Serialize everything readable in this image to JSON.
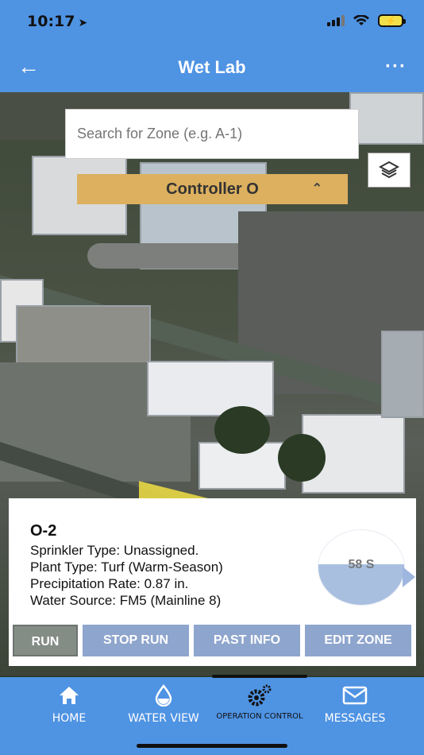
{
  "status_bar": {
    "time": "10:17",
    "battery": "⚡"
  },
  "header": {
    "title": "Wet Lab",
    "back_icon": "back-arrow-icon",
    "more_icon": "more-icon"
  },
  "map": {
    "search": {
      "placeholder": "Search for Zone (e.g. A-1)"
    },
    "controller": {
      "label": "Controller O"
    },
    "highlight_color": "#f1df43"
  },
  "zone": {
    "title": "O-2",
    "sprinkler_type": "Sprinkler Type: Unassigned.",
    "plant_type": "Plant Type: Turf (Warm-Season)",
    "precipitation_rate": "Precipitation Rate: 0.87 in.",
    "water_source": "Water Source: FM5 (Mainline 8)",
    "gauge_label": "58 S"
  },
  "actions": {
    "run": "RUN",
    "stop_run": "STOP RUN",
    "past_info": "PAST INFO",
    "edit_zone": "EDIT ZONE"
  },
  "nav": {
    "home": "HOME",
    "water_view": "WATER VIEW",
    "operation_control": "OPERATION CONTROL",
    "messages": "MESSAGES"
  },
  "colors": {
    "brand_blue": "#4f93e3",
    "controller_gold": "#dcb05f",
    "button_blue": "#8ea5cd",
    "button_gray": "#848c86"
  }
}
